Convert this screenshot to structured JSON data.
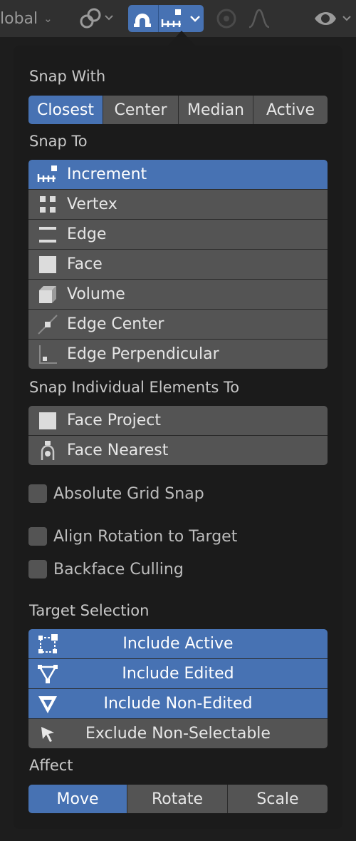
{
  "header": {
    "global_label": "lobal",
    "snap_toggle_active": true
  },
  "colors": {
    "accent": "#4772b3",
    "button": "#545454",
    "panel": "#1b1b1b"
  },
  "snap_with": {
    "label": "Snap With",
    "options": [
      "Closest",
      "Center",
      "Median",
      "Active"
    ],
    "selected": "Closest"
  },
  "snap_to": {
    "label": "Snap To",
    "items": [
      {
        "label": "Increment",
        "icon": "increment-icon",
        "active": true
      },
      {
        "label": "Vertex",
        "icon": "vertex-icon",
        "active": false
      },
      {
        "label": "Edge",
        "icon": "edge-icon",
        "active": false
      },
      {
        "label": "Face",
        "icon": "face-icon",
        "active": false
      },
      {
        "label": "Volume",
        "icon": "volume-icon",
        "active": false
      },
      {
        "label": "Edge Center",
        "icon": "edge-center-icon",
        "active": false
      },
      {
        "label": "Edge Perpendicular",
        "icon": "edge-perpendicular-icon",
        "active": false
      }
    ]
  },
  "snap_individual": {
    "label": "Snap Individual Elements To",
    "items": [
      {
        "label": "Face Project",
        "icon": "face-project-icon",
        "active": false
      },
      {
        "label": "Face Nearest",
        "icon": "face-nearest-icon",
        "active": false
      }
    ]
  },
  "options": {
    "absolute_grid": {
      "label": "Absolute Grid Snap",
      "checked": false
    },
    "align_rotation": {
      "label": "Align Rotation to Target",
      "checked": false
    },
    "backface": {
      "label": "Backface Culling",
      "checked": false
    }
  },
  "target_selection": {
    "label": "Target Selection",
    "items": [
      {
        "label": "Include Active",
        "icon": "include-active-icon",
        "active": true
      },
      {
        "label": "Include Edited",
        "icon": "include-edited-icon",
        "active": true
      },
      {
        "label": "Include Non-Edited",
        "icon": "include-non-edited-icon",
        "active": true
      },
      {
        "label": "Exclude Non-Selectable",
        "icon": "cursor-arrow-icon",
        "active": false
      }
    ]
  },
  "affect": {
    "label": "Affect",
    "options": [
      "Move",
      "Rotate",
      "Scale"
    ],
    "selected": "Move"
  }
}
